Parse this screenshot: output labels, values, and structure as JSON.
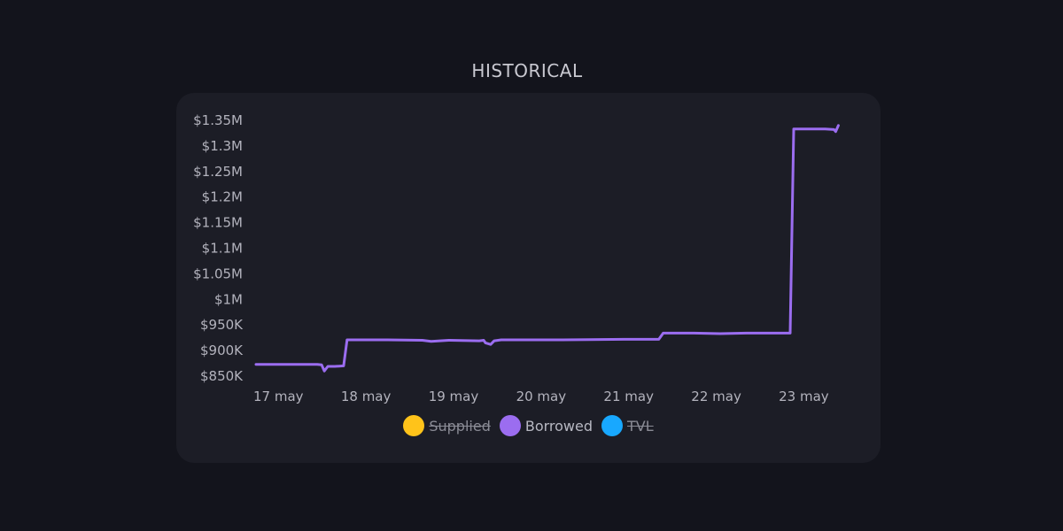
{
  "page": {
    "title": "HISTORICAL"
  },
  "colors": {
    "background": "#13141c",
    "card": "#1c1d26",
    "supplied": "#ffc31a",
    "borrowed": "#9b6df0",
    "tvl": "#18a8ff",
    "axis_text": "#b3b3bd"
  },
  "legend": [
    {
      "label": "Supplied",
      "color": "#ffc31a",
      "active": false
    },
    {
      "label": "Borrowed",
      "color": "#9b6df0",
      "active": true
    },
    {
      "label": "TVL",
      "color": "#18a8ff",
      "active": false
    }
  ],
  "chart_data": {
    "type": "line",
    "title": "HISTORICAL",
    "xlabel": "",
    "ylabel": "",
    "x_ticks": [
      "17 may",
      "18 may",
      "19 may",
      "20 may",
      "21 may",
      "22 may",
      "23 may"
    ],
    "x_range": [
      0,
      7
    ],
    "y_ticks": [
      "$850K",
      "$900K",
      "$950K",
      "$1M",
      "$1.05M",
      "$1.1M",
      "$1.15M",
      "$1.2M",
      "$1.25M",
      "$1.3M",
      "$1.35M"
    ],
    "ylim": [
      850000,
      1350000
    ],
    "grid": false,
    "legend_position": "bottom",
    "series": [
      {
        "name": "Borrowed",
        "color": "#9b6df0",
        "points": [
          [
            0.0,
            873000
          ],
          [
            0.7,
            873000
          ],
          [
            0.75,
            872000
          ],
          [
            0.78,
            860000
          ],
          [
            0.82,
            869000
          ],
          [
            0.9,
            869000
          ],
          [
            1.0,
            870000
          ],
          [
            1.04,
            921000
          ],
          [
            1.5,
            921000
          ],
          [
            1.9,
            920000
          ],
          [
            2.0,
            918000
          ],
          [
            2.2,
            920000
          ],
          [
            2.55,
            919000
          ],
          [
            2.6,
            920000
          ],
          [
            2.62,
            915000
          ],
          [
            2.68,
            912000
          ],
          [
            2.72,
            919000
          ],
          [
            2.8,
            921000
          ],
          [
            3.2,
            921000
          ],
          [
            3.5,
            921000
          ],
          [
            3.8,
            921500
          ],
          [
            4.2,
            922000
          ],
          [
            4.6,
            922000
          ],
          [
            4.65,
            934000
          ],
          [
            5.0,
            934000
          ],
          [
            5.3,
            933000
          ],
          [
            5.6,
            934000
          ],
          [
            6.0,
            934000
          ],
          [
            6.1,
            934000
          ],
          [
            6.14,
            1333000
          ],
          [
            6.3,
            1333000
          ],
          [
            6.5,
            1333000
          ],
          [
            6.6,
            1332000
          ],
          [
            6.62,
            1328000
          ],
          [
            6.65,
            1340000
          ]
        ]
      }
    ]
  }
}
